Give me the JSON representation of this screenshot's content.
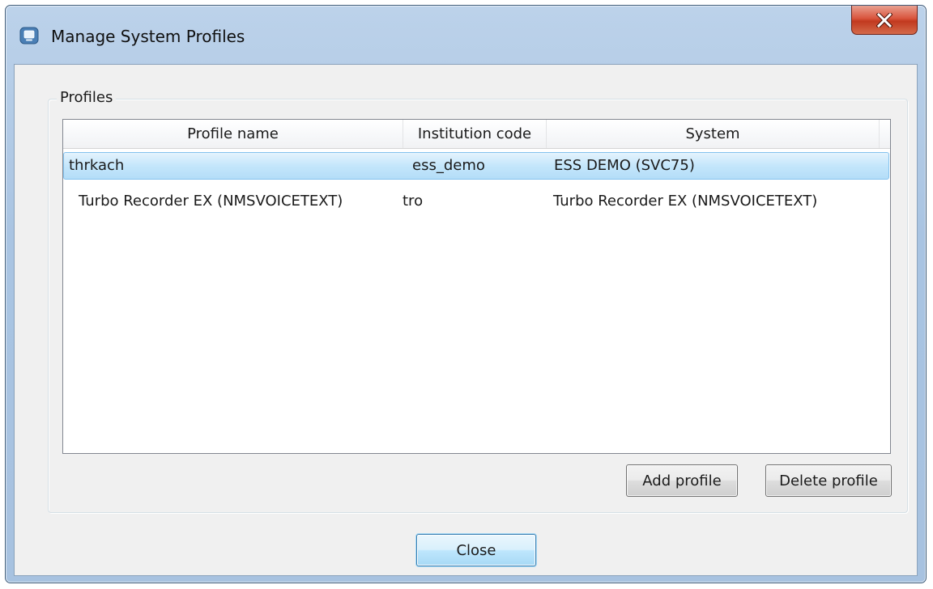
{
  "window": {
    "title": "Manage System Profiles",
    "app_icon": "app-window-icon",
    "close_icon": "close-x-icon",
    "close_color": "#c7402a"
  },
  "group": {
    "label": "Profiles"
  },
  "table": {
    "columns": [
      "Profile name",
      "Institution code",
      "System"
    ],
    "rows": [
      {
        "profile_name": "thrkach",
        "institution_code": "ess_demo",
        "system": "ESS DEMO (SVC75)",
        "selected": true
      },
      {
        "profile_name": "Turbo Recorder EX (NMSVOICETEXT)",
        "institution_code": "tro",
        "system": "Turbo Recorder EX (NMSVOICETEXT)",
        "selected": false
      }
    ],
    "selection_color": "#c4e6fb"
  },
  "buttons": {
    "add_profile": "Add profile",
    "delete_profile": "Delete profile",
    "close": "Close"
  }
}
